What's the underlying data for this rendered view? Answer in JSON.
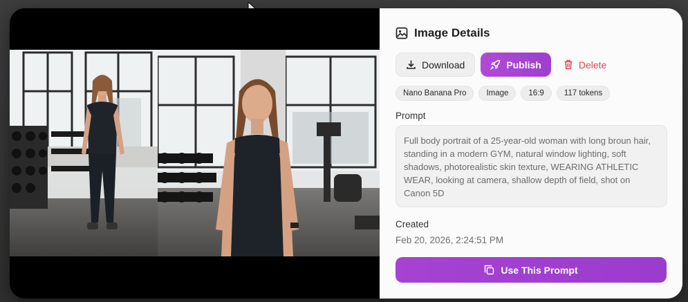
{
  "details": {
    "title": "Image Details",
    "title_icon": "image-icon"
  },
  "actions": {
    "download_label": "Download",
    "publish_label": "Publish",
    "delete_label": "Delete"
  },
  "chips": [
    "Nano Banana Pro",
    "Image",
    "16:9",
    "117 tokens"
  ],
  "prompt": {
    "label": "Prompt",
    "text": "Full body portrait of a 25-year-old woman with long broun hair, standing in a modern GYM, natural window lighting, soft shadows, photorealistic skin texture, WEARING ATHLETIC WEAR, looking at camera, shallow depth of field, shot on Canon 5D"
  },
  "created": {
    "label": "Created",
    "value": "Feb 20, 2026, 2:24:51 PM"
  },
  "use_prompt_label": "Use This Prompt",
  "colors": {
    "accent": "#a742d2",
    "delete": "#e0454d",
    "panel_bg": "#fbfbfb"
  }
}
